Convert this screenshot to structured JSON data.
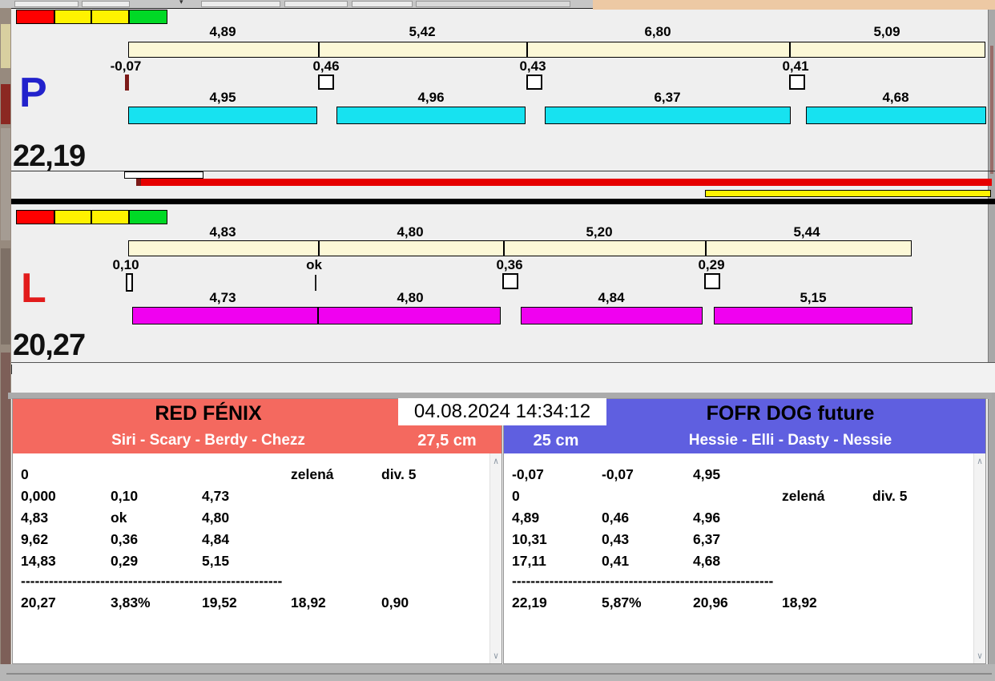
{
  "icons": {
    "scroll_up": "∧",
    "scroll_down": "∨",
    "dropdown_triangle": "▾"
  },
  "colors": {
    "cream_bar": "#FCF8D7",
    "cyan_bar": "#17E2F0",
    "magenta_bar": "#F001F0",
    "progress_red_bar": "#E60000",
    "progress_yellow_bar": "#FFF200",
    "lane_p_letter": "#2222CC",
    "lane_l_letter": "#E21B1B",
    "left_header": "#F4695F",
    "right_header": "#5F5FE0",
    "traffic_lights": [
      "#FF0000",
      "#FFF200",
      "#FFF200",
      "#00D926"
    ]
  },
  "lane_p": {
    "letter": "P",
    "total": "22,19",
    "top_segments": [
      "4,89",
      "5,42",
      "6,80",
      "5,09"
    ],
    "splits": [
      "-0,07",
      "0,46",
      "0,43",
      "0,41"
    ],
    "bottom_segments": [
      "4,95",
      "4,96",
      "6,37",
      "4,68"
    ]
  },
  "lane_l": {
    "letter": "L",
    "total": "20,27",
    "top_segments": [
      "4,83",
      "4,80",
      "5,20",
      "5,44"
    ],
    "splits": [
      "0,10",
      "ok",
      "0,36",
      "0,29"
    ],
    "bottom_segments": [
      "4,73",
      "4,80",
      "4,84",
      "5,15"
    ]
  },
  "scoreboard": {
    "datetime": "04.08.2024 14:34:12",
    "left": {
      "team": "RED FÉNIX",
      "dogs": "Siri - Scary - Berdy - Chezz",
      "jump_height": "27,5 cm",
      "rows": [
        [
          "0",
          "",
          "",
          "zelená",
          "div. 5"
        ],
        [
          "0,000",
          "0,10",
          "4,73",
          "",
          ""
        ],
        [
          "4,83",
          "ok",
          "4,80",
          "",
          ""
        ],
        [
          "9,62",
          "0,36",
          "4,84",
          "",
          ""
        ],
        [
          "14,83",
          "0,29",
          "5,15",
          "",
          ""
        ]
      ],
      "dashes": "--------------------------------------------------------",
      "total_row": [
        "20,27",
        "3,83%",
        "19,52",
        "18,92",
        "0,90"
      ]
    },
    "right": {
      "team": "FOFR DOG future",
      "dogs": "Hessie - Elli - Dasty - Nessie",
      "jump_height": "25 cm",
      "rows": [
        [
          "-0,07",
          "-0,07",
          "4,95",
          "",
          ""
        ],
        [
          "0",
          "",
          "",
          "zelená",
          "div. 5"
        ],
        [
          "4,89",
          "0,46",
          "4,96",
          "",
          ""
        ],
        [
          "10,31",
          "0,43",
          "6,37",
          "",
          ""
        ],
        [
          "17,11",
          "0,41",
          "4,68",
          "",
          ""
        ]
      ],
      "dashes": "--------------------------------------------------------",
      "total_row": [
        "22,19",
        "5,87%",
        "20,96",
        "18,92",
        ""
      ]
    }
  }
}
